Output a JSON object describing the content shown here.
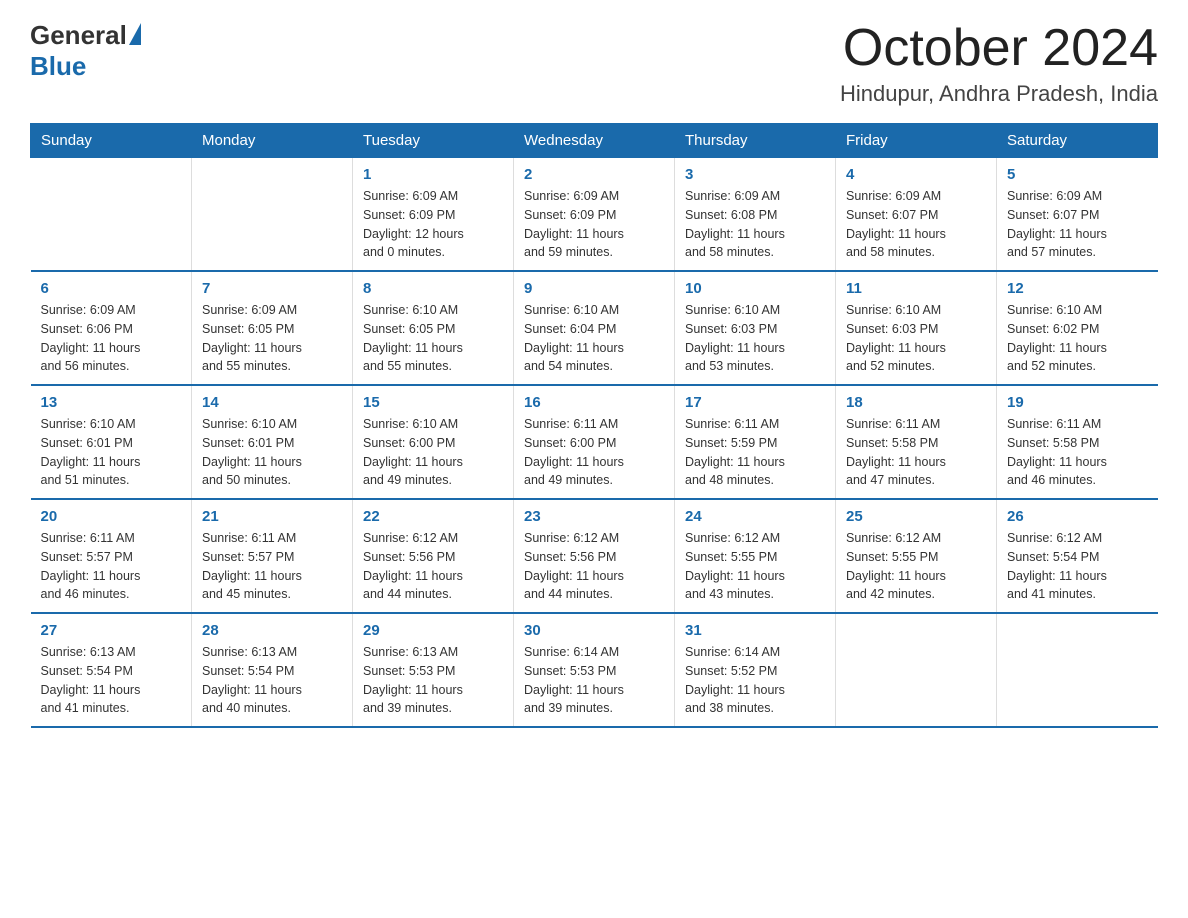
{
  "logo": {
    "general": "General",
    "blue": "Blue"
  },
  "title": "October 2024",
  "location": "Hindupur, Andhra Pradesh, India",
  "weekdays": [
    "Sunday",
    "Monday",
    "Tuesday",
    "Wednesday",
    "Thursday",
    "Friday",
    "Saturday"
  ],
  "weeks": [
    [
      {
        "day": null,
        "info": null
      },
      {
        "day": null,
        "info": null
      },
      {
        "day": "1",
        "info": "Sunrise: 6:09 AM\nSunset: 6:09 PM\nDaylight: 12 hours\nand 0 minutes."
      },
      {
        "day": "2",
        "info": "Sunrise: 6:09 AM\nSunset: 6:09 PM\nDaylight: 11 hours\nand 59 minutes."
      },
      {
        "day": "3",
        "info": "Sunrise: 6:09 AM\nSunset: 6:08 PM\nDaylight: 11 hours\nand 58 minutes."
      },
      {
        "day": "4",
        "info": "Sunrise: 6:09 AM\nSunset: 6:07 PM\nDaylight: 11 hours\nand 58 minutes."
      },
      {
        "day": "5",
        "info": "Sunrise: 6:09 AM\nSunset: 6:07 PM\nDaylight: 11 hours\nand 57 minutes."
      }
    ],
    [
      {
        "day": "6",
        "info": "Sunrise: 6:09 AM\nSunset: 6:06 PM\nDaylight: 11 hours\nand 56 minutes."
      },
      {
        "day": "7",
        "info": "Sunrise: 6:09 AM\nSunset: 6:05 PM\nDaylight: 11 hours\nand 55 minutes."
      },
      {
        "day": "8",
        "info": "Sunrise: 6:10 AM\nSunset: 6:05 PM\nDaylight: 11 hours\nand 55 minutes."
      },
      {
        "day": "9",
        "info": "Sunrise: 6:10 AM\nSunset: 6:04 PM\nDaylight: 11 hours\nand 54 minutes."
      },
      {
        "day": "10",
        "info": "Sunrise: 6:10 AM\nSunset: 6:03 PM\nDaylight: 11 hours\nand 53 minutes."
      },
      {
        "day": "11",
        "info": "Sunrise: 6:10 AM\nSunset: 6:03 PM\nDaylight: 11 hours\nand 52 minutes."
      },
      {
        "day": "12",
        "info": "Sunrise: 6:10 AM\nSunset: 6:02 PM\nDaylight: 11 hours\nand 52 minutes."
      }
    ],
    [
      {
        "day": "13",
        "info": "Sunrise: 6:10 AM\nSunset: 6:01 PM\nDaylight: 11 hours\nand 51 minutes."
      },
      {
        "day": "14",
        "info": "Sunrise: 6:10 AM\nSunset: 6:01 PM\nDaylight: 11 hours\nand 50 minutes."
      },
      {
        "day": "15",
        "info": "Sunrise: 6:10 AM\nSunset: 6:00 PM\nDaylight: 11 hours\nand 49 minutes."
      },
      {
        "day": "16",
        "info": "Sunrise: 6:11 AM\nSunset: 6:00 PM\nDaylight: 11 hours\nand 49 minutes."
      },
      {
        "day": "17",
        "info": "Sunrise: 6:11 AM\nSunset: 5:59 PM\nDaylight: 11 hours\nand 48 minutes."
      },
      {
        "day": "18",
        "info": "Sunrise: 6:11 AM\nSunset: 5:58 PM\nDaylight: 11 hours\nand 47 minutes."
      },
      {
        "day": "19",
        "info": "Sunrise: 6:11 AM\nSunset: 5:58 PM\nDaylight: 11 hours\nand 46 minutes."
      }
    ],
    [
      {
        "day": "20",
        "info": "Sunrise: 6:11 AM\nSunset: 5:57 PM\nDaylight: 11 hours\nand 46 minutes."
      },
      {
        "day": "21",
        "info": "Sunrise: 6:11 AM\nSunset: 5:57 PM\nDaylight: 11 hours\nand 45 minutes."
      },
      {
        "day": "22",
        "info": "Sunrise: 6:12 AM\nSunset: 5:56 PM\nDaylight: 11 hours\nand 44 minutes."
      },
      {
        "day": "23",
        "info": "Sunrise: 6:12 AM\nSunset: 5:56 PM\nDaylight: 11 hours\nand 44 minutes."
      },
      {
        "day": "24",
        "info": "Sunrise: 6:12 AM\nSunset: 5:55 PM\nDaylight: 11 hours\nand 43 minutes."
      },
      {
        "day": "25",
        "info": "Sunrise: 6:12 AM\nSunset: 5:55 PM\nDaylight: 11 hours\nand 42 minutes."
      },
      {
        "day": "26",
        "info": "Sunrise: 6:12 AM\nSunset: 5:54 PM\nDaylight: 11 hours\nand 41 minutes."
      }
    ],
    [
      {
        "day": "27",
        "info": "Sunrise: 6:13 AM\nSunset: 5:54 PM\nDaylight: 11 hours\nand 41 minutes."
      },
      {
        "day": "28",
        "info": "Sunrise: 6:13 AM\nSunset: 5:54 PM\nDaylight: 11 hours\nand 40 minutes."
      },
      {
        "day": "29",
        "info": "Sunrise: 6:13 AM\nSunset: 5:53 PM\nDaylight: 11 hours\nand 39 minutes."
      },
      {
        "day": "30",
        "info": "Sunrise: 6:14 AM\nSunset: 5:53 PM\nDaylight: 11 hours\nand 39 minutes."
      },
      {
        "day": "31",
        "info": "Sunrise: 6:14 AM\nSunset: 5:52 PM\nDaylight: 11 hours\nand 38 minutes."
      },
      {
        "day": null,
        "info": null
      },
      {
        "day": null,
        "info": null
      }
    ]
  ]
}
